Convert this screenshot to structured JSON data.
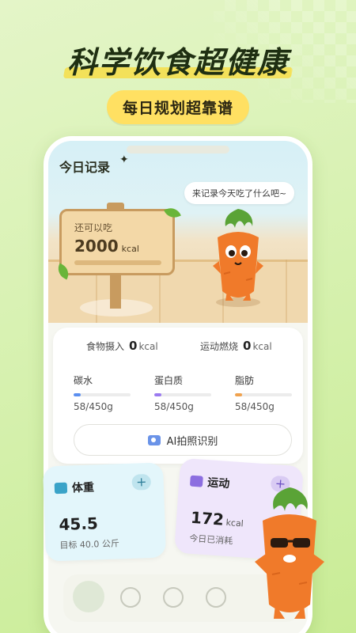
{
  "promo": {
    "headline": "科学饮食超健康",
    "tagline": "每日规划超靠谱"
  },
  "record": {
    "title": "今日记录",
    "speech": "来记录今天吃了什么吧~",
    "sign_label": "还可以吃",
    "sign_value": "2000",
    "sign_unit": "kcal"
  },
  "summary": {
    "intake_label": "食物摄入",
    "intake_value": "0",
    "intake_unit": "kcal",
    "burn_label": "运动燃烧",
    "burn_value": "0",
    "burn_unit": "kcal",
    "nutrients": [
      {
        "name": "碳水",
        "value": "58/450g",
        "progress": 0.13,
        "color": "#5b8ff0"
      },
      {
        "name": "蛋白质",
        "value": "58/450g",
        "progress": 0.13,
        "color": "#9b7af0"
      },
      {
        "name": "脂肪",
        "value": "58/450g",
        "progress": 0.13,
        "color": "#f0a24e"
      }
    ],
    "ai_button": "AI拍照识别"
  },
  "weight": {
    "title": "体重",
    "value": "45.5",
    "goal_text": "目标 40.0 公斤",
    "plus": "+"
  },
  "sport": {
    "title": "运动",
    "value": "172",
    "unit": "kcal",
    "sub": "今日已消耗",
    "plus": "+"
  },
  "colors": {
    "accent_yellow": "#ffe062",
    "carrot_orange": "#f07a2a",
    "leaf_green": "#5aa336"
  }
}
